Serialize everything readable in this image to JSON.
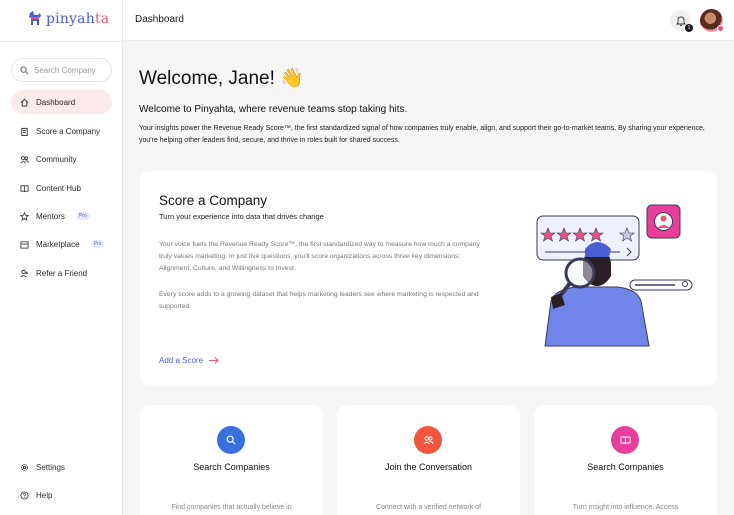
{
  "brand": {
    "name_a": "pinyah",
    "name_b": "ta",
    "accent": "#4a5ed6",
    "pink": "#e8557d"
  },
  "sidebar": {
    "search_placeholder": "Search Company",
    "items": [
      {
        "label": "Dashboard",
        "icon": "home-icon",
        "active": true
      },
      {
        "label": "Score a Company",
        "icon": "clipboard-icon"
      },
      {
        "label": "Community",
        "icon": "people-icon"
      },
      {
        "label": "Content Hub",
        "icon": "book-icon"
      },
      {
        "label": "Mentors",
        "icon": "star-icon",
        "badge": "Pro"
      },
      {
        "label": "Marketplace",
        "icon": "store-icon",
        "badge": "Pro"
      },
      {
        "label": "Refer a Friend",
        "icon": "add-user-icon"
      }
    ],
    "bottom": [
      {
        "label": "Settings",
        "icon": "gear-icon"
      },
      {
        "label": "Help",
        "icon": "help-icon"
      }
    ]
  },
  "header": {
    "title": "Dashboard",
    "notifications": "1"
  },
  "main": {
    "welcome": "Welcome, Jane! 👋",
    "intro": "Welcome to Pinyahta, where revenue teams stop taking hits.",
    "intro_text": "Your insights power the Revenue Ready Score™, the first standardized signal of how companies truly enable, align, and support their go-to-market teams. By sharing your experience, you're helping other leaders find, secure, and thrive in roles built for shared success.",
    "score_card": {
      "title": "Score a Company",
      "subtitle": "Turn your experience into data that drives change",
      "p1": "Your voice fuels the Revenue Ready Score™, the first standardized way to measure how much a company truly values marketing. In just five questions, you'll score organizations across three key dimensions: Alignment, Culture, and Willingness to Invest.",
      "p2": "Every score adds to a growing dataset that helps marketing leaders see where marketing is respected and supported.",
      "link": "Add a Score",
      "rating_stars": 4
    },
    "cards": [
      {
        "title": "Search Companies",
        "desc": "Find companies that actually believe in",
        "icon": "search-icon",
        "color": "#3b6fe0"
      },
      {
        "title": "Join the Conversation",
        "desc": "Connect with a verified network of",
        "icon": "people-icon",
        "color": "#f0553e"
      },
      {
        "title": "Search Companies",
        "desc": "Turn insight into influence. Access",
        "icon": "book-icon",
        "color": "#e8409a"
      }
    ]
  }
}
